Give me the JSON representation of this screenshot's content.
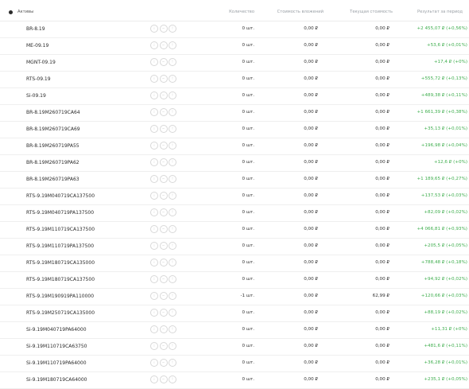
{
  "header": {
    "assets": "Активы",
    "quantity": "Количество",
    "investment": "Стоимость вложений",
    "current_price": "Текущая стоимость",
    "result": "Результат за период"
  },
  "colors": {
    "positive": "#3fae4e",
    "text": "#2a2a2a",
    "muted": "#9aa0a6"
  },
  "rows": [
    {
      "name": "BR-8.19",
      "qty": "0 шт.",
      "invest": "0,00 ₽",
      "price": "0,00 ₽",
      "result": "+2 455,07 ₽ (+0,56%)"
    },
    {
      "name": "ME-09.19",
      "qty": "0 шт.",
      "invest": "0,00 ₽",
      "price": "0,00 ₽",
      "result": "+53,6 ₽ (+0,01%)"
    },
    {
      "name": "MGNT-09.19",
      "qty": "0 шт.",
      "invest": "0,00 ₽",
      "price": "0,00 ₽",
      "result": "+17,4 ₽ (+0%)"
    },
    {
      "name": "RTS-09.19",
      "qty": "0 шт.",
      "invest": "0,00 ₽",
      "price": "0,00 ₽",
      "result": "+555,72 ₽ (+0,13%)"
    },
    {
      "name": "Si-09.19",
      "qty": "0 шт.",
      "invest": "0,00 ₽",
      "price": "0,00 ₽",
      "result": "+489,38 ₽ (+0,11%)"
    },
    {
      "name": "BR-8.19M260719CA64",
      "qty": "0 шт.",
      "invest": "0,00 ₽",
      "price": "0,00 ₽",
      "result": "+1 661,39 ₽ (+0,38%)"
    },
    {
      "name": "BR-8.19M260719CA69",
      "qty": "0 шт.",
      "invest": "0,00 ₽",
      "price": "0,00 ₽",
      "result": "+35,13 ₽ (+0,01%)"
    },
    {
      "name": "BR-8.19M260719PA55",
      "qty": "0 шт.",
      "invest": "0,00 ₽",
      "price": "0,00 ₽",
      "result": "+196,98 ₽ (+0,04%)"
    },
    {
      "name": "BR-8.19M260719PA62",
      "qty": "0 шт.",
      "invest": "0,00 ₽",
      "price": "0,00 ₽",
      "result": "+12,6 ₽ (+0%)"
    },
    {
      "name": "BR-8.19M260719PA63",
      "qty": "0 шт.",
      "invest": "0,00 ₽",
      "price": "0,00 ₽",
      "result": "+1 189,65 ₽ (+0,27%)"
    },
    {
      "name": "RTS-9.19M040719CA137500",
      "qty": "0 шт.",
      "invest": "0,00 ₽",
      "price": "0,00 ₽",
      "result": "+137,53 ₽ (+0,03%)"
    },
    {
      "name": "RTS-9.19M040719PA137500",
      "qty": "0 шт.",
      "invest": "0,00 ₽",
      "price": "0,00 ₽",
      "result": "+82,09 ₽ (+0,02%)"
    },
    {
      "name": "RTS-9.19M110719CA137500",
      "qty": "0 шт.",
      "invest": "0,00 ₽",
      "price": "0,00 ₽",
      "result": "+4 066,81 ₽ (+0,93%)"
    },
    {
      "name": "RTS-9.19M110719PA137500",
      "qty": "0 шт.",
      "invest": "0,00 ₽",
      "price": "0,00 ₽",
      "result": "+205,5 ₽ (+0,05%)"
    },
    {
      "name": "RTS-9.19M180719CA135000",
      "qty": "0 шт.",
      "invest": "0,00 ₽",
      "price": "0,00 ₽",
      "result": "+788,48 ₽ (+0,18%)"
    },
    {
      "name": "RTS-9.19M180719CA137500",
      "qty": "0 шт.",
      "invest": "0,00 ₽",
      "price": "0,00 ₽",
      "result": "+94,92 ₽ (+0,02%)"
    },
    {
      "name": "RTS-9.19M190919PA110000",
      "qty": "-1 шт.",
      "invest": "0,00 ₽",
      "price": "62,99 ₽",
      "result": "+120,66 ₽ (+0,03%)"
    },
    {
      "name": "RTS-9.19M250719CA135000",
      "qty": "0 шт.",
      "invest": "0,00 ₽",
      "price": "0,00 ₽",
      "result": "+88,19 ₽ (+0,02%)"
    },
    {
      "name": "Si-9.19M040719PA64000",
      "qty": "0 шт.",
      "invest": "0,00 ₽",
      "price": "0,00 ₽",
      "result": "+11,31 ₽ (+0%)"
    },
    {
      "name": "Si-9.19M110719CA63750",
      "qty": "0 шт.",
      "invest": "0,00 ₽",
      "price": "0,00 ₽",
      "result": "+481,6 ₽ (+0,11%)"
    },
    {
      "name": "Si-9.19M110719PA64000",
      "qty": "0 шт.",
      "invest": "0,00 ₽",
      "price": "0,00 ₽",
      "result": "+36,28 ₽ (+0,01%)"
    },
    {
      "name": "Si-9.19M180719CA64000",
      "qty": "0 шт.",
      "invest": "0,00 ₽",
      "price": "0,00 ₽",
      "result": "+235,1 ₽ (+0,05%)"
    }
  ]
}
